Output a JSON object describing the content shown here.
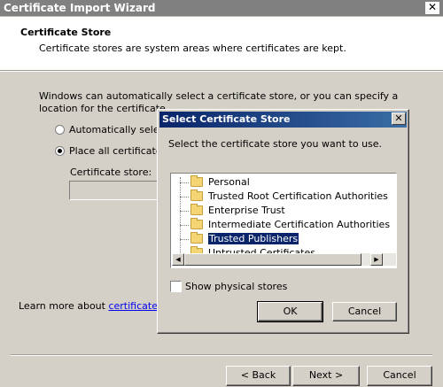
{
  "window": {
    "title": "Certificate Import Wizard",
    "close_glyph": "✕"
  },
  "header": {
    "title": "Certificate Store",
    "description": "Certificate stores are system areas where certificates are kept."
  },
  "body": {
    "intro": "Windows can automatically select a certificate store, or you can specify a location for the certificate.",
    "radio_auto_label": "Automatically select t",
    "radio_place_label": "Place all certificates i",
    "radio_selected": "place",
    "store_label": "Certificate store:",
    "store_value": "",
    "learn_more_prefix": "Learn more about ",
    "learn_more_link": "certificate stor"
  },
  "footer": {
    "back_label": "< Back",
    "next_label": "Next >",
    "cancel_label": "Cancel"
  },
  "dialog": {
    "title": "Select Certificate Store",
    "close_glyph": "✕",
    "prompt": "Select the certificate store you want to use.",
    "stores": [
      {
        "label": "Personal",
        "selected": false
      },
      {
        "label": "Trusted Root Certification Authorities",
        "selected": false
      },
      {
        "label": "Enterprise Trust",
        "selected": false
      },
      {
        "label": "Intermediate Certification Authorities",
        "selected": false
      },
      {
        "label": "Trusted Publishers",
        "selected": true
      },
      {
        "label": "Untrusted Certificates",
        "selected": false
      }
    ],
    "show_physical_label": "Show physical stores",
    "show_physical_checked": false,
    "ok_label": "OK",
    "cancel_label": "Cancel",
    "icons": {
      "folder": "folder-icon",
      "scroll_up": "▲",
      "scroll_down": "▼",
      "scroll_left": "◀",
      "scroll_right": "▶"
    }
  }
}
